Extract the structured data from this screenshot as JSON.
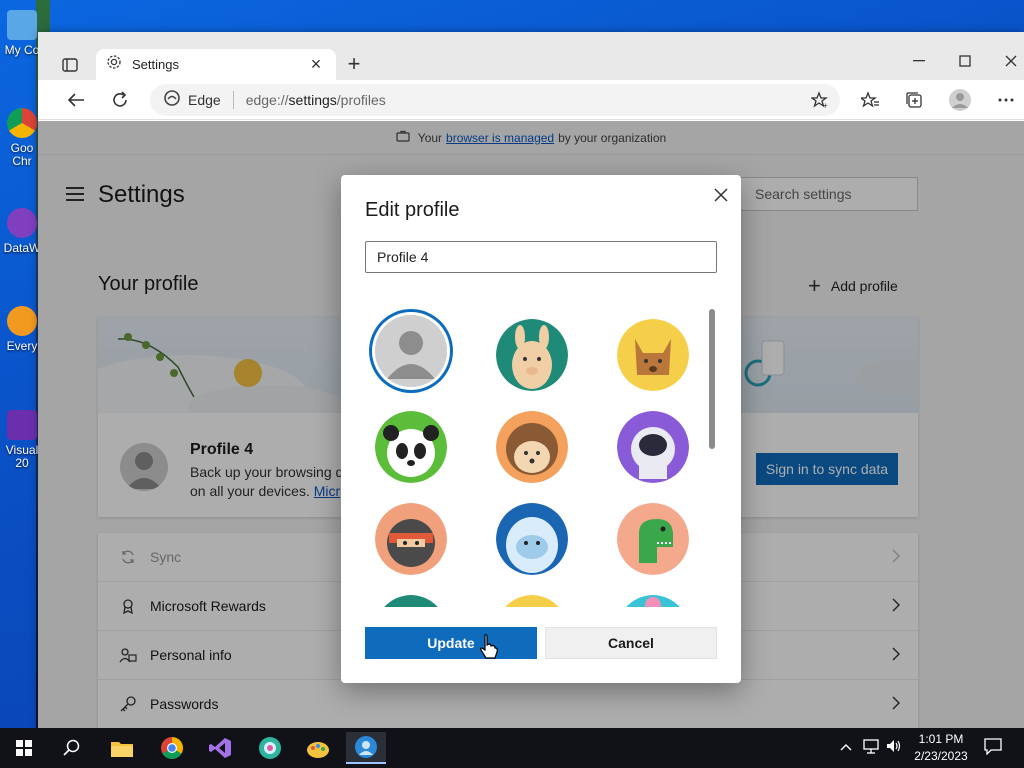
{
  "desktop": {
    "icons": [
      {
        "label": "My Co"
      },
      {
        "label": "Goo\nChr"
      },
      {
        "label": "DataW"
      },
      {
        "label": "Every"
      },
      {
        "label": "Visual\n20"
      }
    ]
  },
  "browser": {
    "tab": {
      "title": "Settings"
    },
    "address": {
      "brand": "Edge",
      "url_prefix": "edge://",
      "url_main": "settings",
      "url_path": "/profiles"
    }
  },
  "page": {
    "managed_prefix": "Your",
    "managed_link": "browser is managed",
    "managed_suffix": "by your organization",
    "settings_title": "Settings",
    "search_placeholder": "Search settings",
    "your_profile": "Your profile",
    "add_profile": "Add profile",
    "profile_name": "Profile 4",
    "profile_desc": "Back up your browsing d",
    "profile_desc2": "on all your devices.",
    "profile_desc_link": "Micr",
    "signin_button": "Sign in to sync data",
    "list_items": [
      {
        "label": "Sync",
        "icon": "sync-icon"
      },
      {
        "label": "Microsoft Rewards",
        "icon": "rewards-icon"
      },
      {
        "label": "Personal info",
        "icon": "person-info-icon"
      },
      {
        "label": "Passwords",
        "icon": "key-icon"
      }
    ]
  },
  "dialog": {
    "title": "Edit profile",
    "name_value": "Profile 4",
    "avatars": [
      "default-avatar",
      "llama-avatar",
      "fox-avatar",
      "panda-avatar",
      "hedgehog-avatar",
      "astronaut-avatar",
      "ninja-avatar",
      "yeti-avatar",
      "dinosaur-avatar"
    ],
    "update_button": "Update",
    "cancel_button": "Cancel"
  },
  "taskbar": {
    "time": "1:01 PM",
    "date": "2/23/2023"
  },
  "colors": {
    "accent": "#0f6cbd",
    "link": "#0b57c7"
  }
}
